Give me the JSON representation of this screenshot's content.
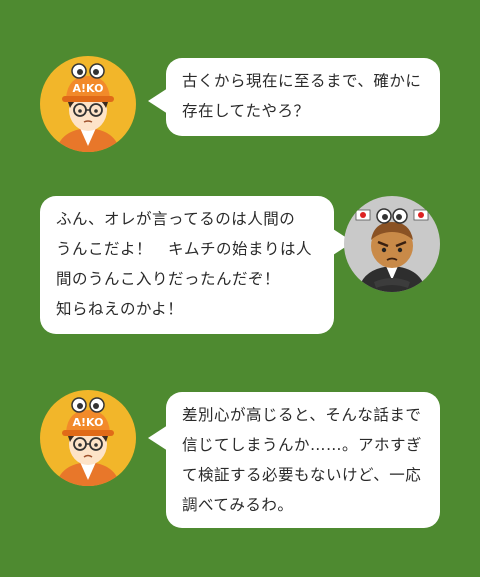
{
  "colors": {
    "background": "#4e8a30",
    "bubble": "#ffffff",
    "aiko_avatar_bg": "#f2b62a",
    "kimchi_avatar_bg": "#c9c9c9"
  },
  "avatars": {
    "aiko_cap_text": "A!KO"
  },
  "dialogue": [
    {
      "speaker": "aiko",
      "lines": [
        "古くから現在に至るまで、確かに",
        "存在してたやろ？"
      ]
    },
    {
      "speaker": "kimchi",
      "lines": [
        "ふん、オレが言ってるのは人間の",
        "うんこだよ！　キムチの始まりは人",
        "間のうんこ入りだったんだぞ！",
        "知らねえのかよ！"
      ]
    },
    {
      "speaker": "aiko",
      "lines": [
        "差別心が高じると、そんな話まで",
        "信じてしまうんか……。アホすぎ",
        "て検証する必要もないけど、一応",
        "調べてみるわ。"
      ]
    }
  ]
}
